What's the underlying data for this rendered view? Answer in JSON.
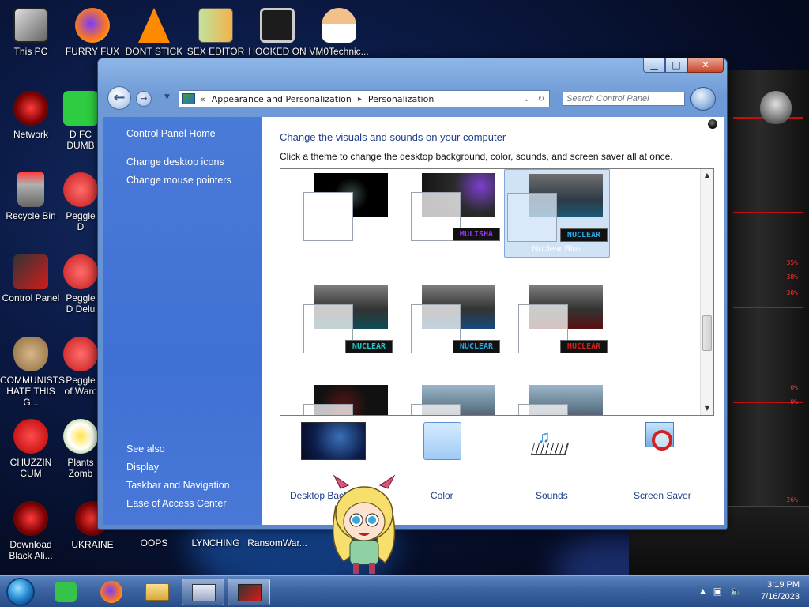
{
  "desktop": {
    "icons": [
      {
        "label": "This PC"
      },
      {
        "label": "FURRY FUX"
      },
      {
        "label": "DONT STICK"
      },
      {
        "label": "SEX EDITOR"
      },
      {
        "label": "HOOKED ON"
      },
      {
        "label": "VM0Technic..."
      },
      {
        "label": "Network"
      },
      {
        "label": "D FC DUMB"
      },
      {
        "label": "Recycle Bin"
      },
      {
        "label": "Peggle D"
      },
      {
        "label": "Control Panel"
      },
      {
        "label": "Peggle D Delu"
      },
      {
        "label": "COMMUNISTS HATE THIS G..."
      },
      {
        "label": "Peggle of Warc"
      },
      {
        "label": "CHUZZIN CUM"
      },
      {
        "label": "Plants Zomb"
      },
      {
        "label": "Download Black Ali..."
      },
      {
        "label": "UKRAINE"
      },
      {
        "label": "OOPS"
      },
      {
        "label": "LYNCHING"
      },
      {
        "label": "RansomWar..."
      }
    ]
  },
  "window": {
    "caption": {
      "minimize": "▁",
      "maximize": "□",
      "close": "✕"
    },
    "address": {
      "chevrons": "«",
      "crumb1": "Appearance and Personalization",
      "separator": "▸",
      "crumb2": "Personalization",
      "dropdown": "⌄",
      "refresh": "↻"
    },
    "search_placeholder": "Search Control Panel",
    "sidebar": {
      "home": "Control Panel Home",
      "link1": "Change desktop icons",
      "link2": "Change mouse pointers",
      "see_also": "See also",
      "link3": "Display",
      "link4": "Taskbar and Navigation",
      "link5": "Ease of Access Center"
    },
    "main": {
      "heading": "Change the visuals and sounds on your computer",
      "subheading": "Click a theme to change the desktop background, color, sounds, and screen saver all at once.",
      "themes": [
        {
          "badge": ""
        },
        {
          "badge": "MULISHA",
          "badge_color": "#9b30ff"
        },
        {
          "badge": "NUCLEAR",
          "badge_color": "#2aa8e8",
          "name": "Nuclear Blue",
          "selected": true
        },
        {
          "badge": "NUCLEAR",
          "badge_color": "#28c7c7"
        },
        {
          "badge": "NUCLEAR",
          "badge_color": "#2aa8e8"
        },
        {
          "badge": "NUCLEAR",
          "badge_color": "#d02020"
        },
        {
          "badge": ""
        },
        {
          "badge": ""
        },
        {
          "badge": ""
        }
      ],
      "tools": {
        "desktop_background": "Desktop Back",
        "color": "Color",
        "sounds": "Sounds",
        "screen_saver": "Screen Saver"
      }
    }
  },
  "taskbar": {
    "time": "3:19 PM",
    "date": "7/16/2023",
    "tray_arrow": "▲"
  },
  "colors": {
    "accent": "#1e3f8a",
    "sidebar": "#3f70d4",
    "taskbar": "#3d66a3"
  }
}
